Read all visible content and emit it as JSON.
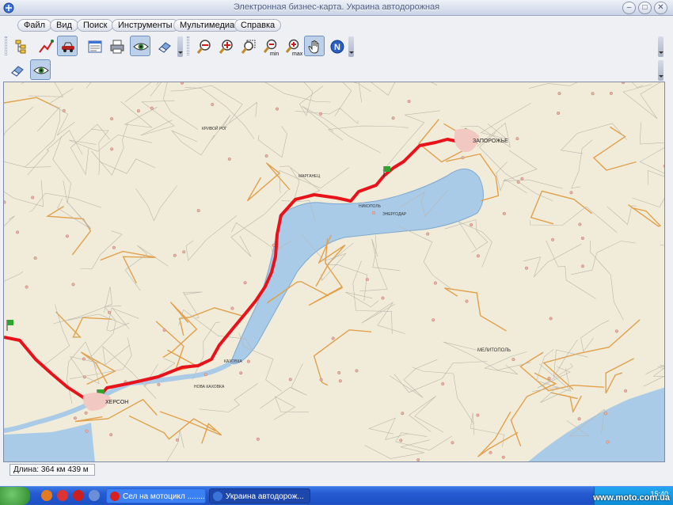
{
  "window": {
    "title": "Электронная бизнес-карта. Украина автодорожная",
    "minimize_glyph": "–",
    "maximize_glyph": "□",
    "close_glyph": "✕"
  },
  "menu": [
    {
      "label": "Файл"
    },
    {
      "label": "Вид"
    },
    {
      "label": "Поиск"
    },
    {
      "label": "Инструменты"
    },
    {
      "label": "Мультимедиа"
    },
    {
      "label": "Справка"
    }
  ],
  "toolbar": {
    "icons": [
      "layers-tree-icon",
      "route-tool-icon",
      "car-route-icon",
      "table-window-icon",
      "print-icon",
      "eye-icon",
      "eraser-icon",
      "zoom-out-icon",
      "zoom-in-icon",
      "zoom-rect-icon",
      "zoom-min-icon",
      "zoom-max-icon",
      "hand-pan-icon",
      "north-icon"
    ],
    "zoom_min_label": "min",
    "zoom_max_label": "max",
    "north_label": "N"
  },
  "map": {
    "cities": [
      {
        "name": "ЗАПОРОЖЬЕ"
      },
      {
        "name": "ХЕРСОН"
      },
      {
        "name": "НИКОПОЛЬ"
      },
      {
        "name": "МЕЛИТОПОЛЬ"
      },
      {
        "name": "КАХОВКА"
      },
      {
        "name": "НОВА КАХОВКА"
      },
      {
        "name": "МАРГАНЕЦ"
      },
      {
        "name": "ЭНЕРГОДАР"
      },
      {
        "name": "КРИВОЙ РОГ"
      }
    ],
    "colors": {
      "land": "#f1ecd9",
      "water": "#a9cbe8",
      "route": "#e8121b",
      "road": "#e1a04c"
    }
  },
  "status": {
    "length": "Длина: 364 км 439 м"
  },
  "taskbar": {
    "tasks": [
      {
        "label": "Сел на мотоцикл ........"
      },
      {
        "label": "Украина автодорож..."
      }
    ],
    "clock": "15:40"
  },
  "watermark": "www.moto.com.ua"
}
